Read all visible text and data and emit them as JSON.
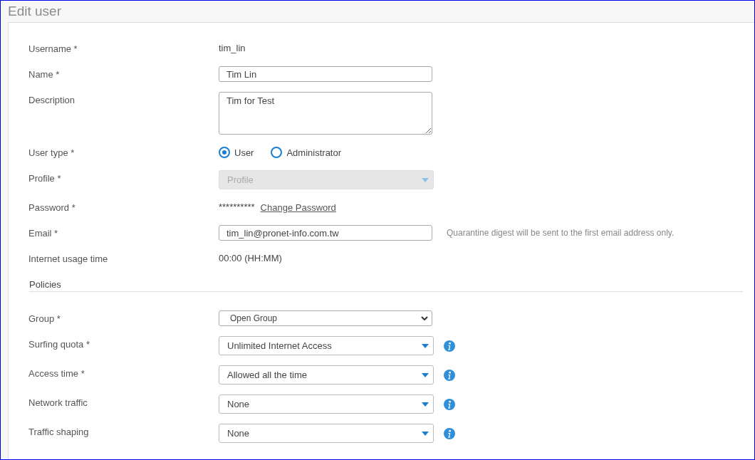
{
  "page": {
    "title": "Edit user"
  },
  "fields": [
    {
      "kind": "text",
      "label": "Username *",
      "value": "tim_lin"
    },
    {
      "kind": "input",
      "label": "Name *",
      "value": "Tim Lin"
    },
    {
      "kind": "textarea",
      "label": "Description",
      "value": "Tim for Test"
    },
    {
      "kind": "radio",
      "label": "User type *",
      "options": [
        {
          "label": "User",
          "selected": true
        },
        {
          "label": "Administrator",
          "selected": false
        }
      ]
    },
    {
      "kind": "select",
      "label": "Profile *",
      "placeholder": "Profile",
      "disabled": true
    },
    {
      "kind": "password",
      "label": "Password *",
      "value": "**********",
      "link": "Change Password"
    },
    {
      "kind": "input",
      "label": "Email *",
      "value": "tim_lin@pronet-info.com.tw",
      "hint": "Quarantine digest will be sent to the first email address only."
    },
    {
      "kind": "text",
      "label": "Internet usage time",
      "value": "00:00 (HH:MM)"
    }
  ],
  "policies": {
    "title": "Policies",
    "fields": [
      {
        "kind": "native-select",
        "label": "Group *",
        "value": "Open Group"
      },
      {
        "kind": "select",
        "label": "Surfing quota *",
        "value": "Unlimited Internet Access",
        "disabled": false,
        "info": true
      },
      {
        "kind": "select",
        "label": "Access time *",
        "value": "Allowed all the time",
        "disabled": false,
        "info": true
      },
      {
        "kind": "select",
        "label": "Network traffic",
        "value": "None",
        "disabled": false,
        "info": true
      },
      {
        "kind": "select",
        "label": "Traffic shaping",
        "value": "None",
        "disabled": false,
        "info": true
      }
    ]
  }
}
